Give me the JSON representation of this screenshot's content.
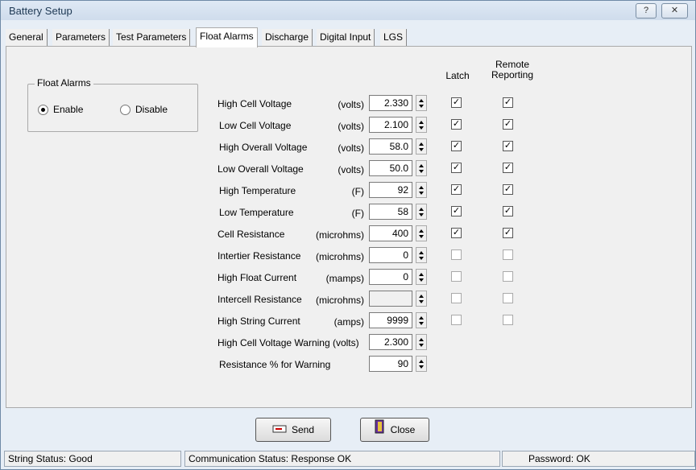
{
  "window": {
    "title": "Battery Setup",
    "help_glyph": "?",
    "close_glyph": "✕"
  },
  "tabs": [
    "General",
    "Parameters",
    "Test Parameters",
    "Float Alarms",
    "Discharge",
    "Digital Input",
    "LGS"
  ],
  "active_tab": "Float Alarms",
  "float_alarms_group": {
    "title": "Float Alarms",
    "enable_label": "Enable",
    "disable_label": "Disable",
    "selected": "Enable"
  },
  "columns": {
    "latch": "Latch",
    "remote": "Remote Reporting"
  },
  "rows": [
    {
      "label": "High Cell Voltage",
      "unit": "(volts)",
      "value": "2.330",
      "latch": true,
      "remote": true
    },
    {
      "label": "Low Cell Voltage",
      "unit": "(volts)",
      "value": "2.100",
      "latch": true,
      "remote": true
    },
    {
      "label": "High Overall Voltage",
      "unit": "(volts)",
      "value": "58.0",
      "latch": true,
      "remote": true
    },
    {
      "label": "Low Overall Voltage",
      "unit": "(volts)",
      "value": "50.0",
      "latch": true,
      "remote": true
    },
    {
      "label": "High Temperature",
      "unit": "(F)",
      "value": "92",
      "latch": true,
      "remote": true
    },
    {
      "label": "Low Temperature",
      "unit": "(F)",
      "value": "58",
      "latch": true,
      "remote": true
    },
    {
      "label": "Cell Resistance",
      "unit": "(microhms)",
      "value": "400",
      "latch": true,
      "remote": true
    },
    {
      "label": "Intertier Resistance",
      "unit": "(microhms)",
      "value": "0",
      "latch": false,
      "remote": false
    },
    {
      "label": "High Float Current",
      "unit": "(mamps)",
      "value": "0",
      "latch": false,
      "remote": false
    },
    {
      "label": "Intercell Resistance",
      "unit": "(microhms)",
      "value": "",
      "latch": false,
      "remote": false,
      "disabled": true
    },
    {
      "label": "High String  Current",
      "unit": "(amps)",
      "value": "9999",
      "latch": false,
      "remote": false
    },
    {
      "label": "High Cell Voltage Warning (volts)",
      "unit": "",
      "value": "2.300"
    },
    {
      "label": "Resistance % for Warning",
      "unit": "",
      "value": "90"
    }
  ],
  "buttons": {
    "send": "Send",
    "close": "Close"
  },
  "status": {
    "string_label": "String Status:",
    "string_value": "Good",
    "comm_label": "Communication Status:",
    "comm_value": "Response OK",
    "password_label": "Password:",
    "password_value": "OK"
  },
  "colors": {
    "accent": "#1e3954",
    "check": "#000000"
  }
}
